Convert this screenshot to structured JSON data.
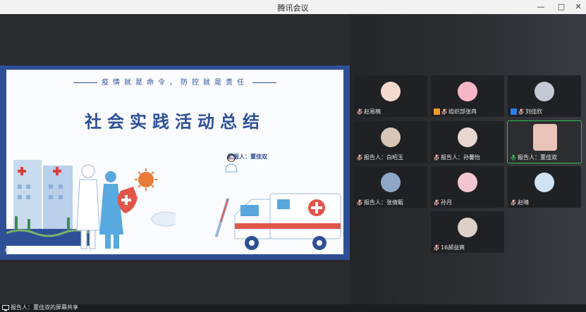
{
  "window": {
    "title": "腾讯会议",
    "minimize_icon": "minimize-icon",
    "maximize_icon": "maximize-icon",
    "close_icon": "close-icon"
  },
  "slide": {
    "slogan": "疫情就是命令，防控就是责任",
    "title": "社会实践活动总结",
    "reporter": "汇报人：董佳双"
  },
  "participants": [
    {
      "name": "赵易楠",
      "mic": "muted",
      "badge": "",
      "avatar_color": "#f3d9d0"
    },
    {
      "name": "组织部张冉",
      "mic": "muted",
      "badge": "orange",
      "avatar_color": "#f7b6c8"
    },
    {
      "name": "刘佳欣",
      "mic": "muted",
      "badge": "blue",
      "avatar_color": "#c5c9d6"
    },
    {
      "name": "报告人：白昭玉",
      "mic": "muted",
      "badge": "",
      "avatar_color": "#d8c7b8"
    },
    {
      "name": "报告人：孙馨怡",
      "mic": "muted",
      "badge": "",
      "avatar_color": "#e8d7d0"
    },
    {
      "name": "报告人：董佳双",
      "mic": "speaking",
      "badge": "",
      "avatar_color": "#e9c2b8"
    },
    {
      "name": "报告人：张倩甄",
      "mic": "muted",
      "badge": "",
      "avatar_color": "#8ea6c8"
    },
    {
      "name": "孙月",
      "mic": "muted",
      "badge": "",
      "avatar_color": "#f3c7d2"
    },
    {
      "name": "赵晴",
      "mic": "muted",
      "badge": "",
      "avatar_color": "#cfe3f3"
    },
    {
      "name": "16郝益爽",
      "mic": "muted",
      "badge": "",
      "avatar_color": "#ddd0c8"
    }
  ],
  "status": {
    "share_text": "报告人：董佳双的屏幕共享"
  },
  "colors": {
    "accent": "#2e4f96",
    "speaking": "#2fbf4f",
    "badge_orange": "#f29b2e",
    "badge_blue": "#2f7ee8"
  }
}
